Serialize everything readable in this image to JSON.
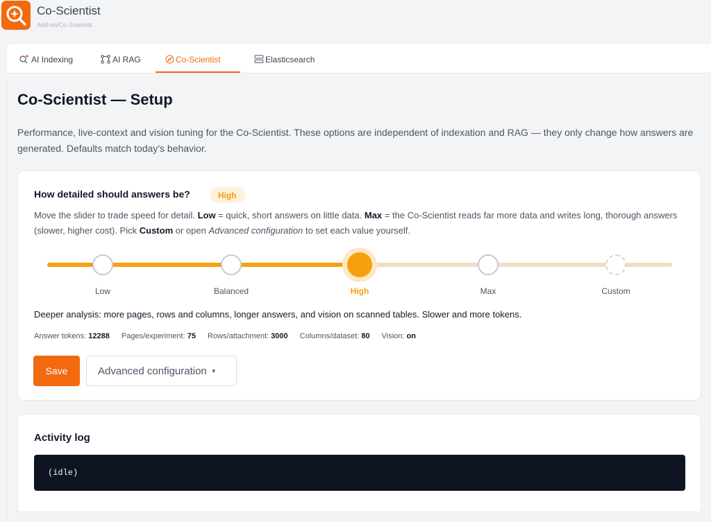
{
  "app": {
    "title": "Co-Scientist",
    "breadcrumb": "Add-on/Co-Scientist",
    "logo_icon": "search-sparkle-icon",
    "accent_color": "#f26a0f"
  },
  "tabs": [
    {
      "label": "AI Indexing",
      "icon": "search-sparkle-icon",
      "active": false
    },
    {
      "label": "AI RAG",
      "icon": "nodes-icon",
      "active": false
    },
    {
      "label": "Co-Scientist",
      "icon": "compass-icon",
      "active": true
    },
    {
      "label": "Elasticsearch",
      "icon": "database-icon",
      "active": false
    }
  ],
  "page": {
    "title": "Co-Scientist — Setup",
    "description": "Performance, live-context and vision tuning for the Co-Scientist. These options are independent of indexation and RAG — they only change how answers are generated. Defaults match today's behavior."
  },
  "detail": {
    "title": "How detailed should answers be?",
    "current_level": "High",
    "help": {
      "intro": "Move the slider to trade speed for detail.",
      "low_term": "Low",
      "low_text": "= quick, short answers on little data.",
      "max_term": "Max",
      "max_text": "= the Co-Scientist reads far more data and writes long, thorough answers (slower, higher cost). Pick",
      "custom_term": "Custom",
      "or_open": "or open",
      "advanced_term": "Advanced configuration",
      "outro": "to set each value yourself."
    },
    "slider": {
      "stops": [
        "Low",
        "Balanced",
        "High",
        "Max",
        "Custom"
      ],
      "selected_index": 2,
      "fill_color": "#f5a00c"
    },
    "summary": "Deeper analysis: more pages, rows and columns, longer answers, and vision on scanned tables. Slower and more tokens.",
    "stats": [
      {
        "label": "Answer tokens:",
        "value": "12288"
      },
      {
        "label": "Pages/experiment:",
        "value": "75"
      },
      {
        "label": "Rows/attachment:",
        "value": "3000"
      },
      {
        "label": "Columns/dataset:",
        "value": "80"
      },
      {
        "label": "Vision:",
        "value": "on"
      }
    ],
    "save_label": "Save",
    "advanced_label": "Advanced configuration",
    "advanced_caret": "▼"
  },
  "log": {
    "title": "Activity log",
    "content": "(idle)"
  }
}
